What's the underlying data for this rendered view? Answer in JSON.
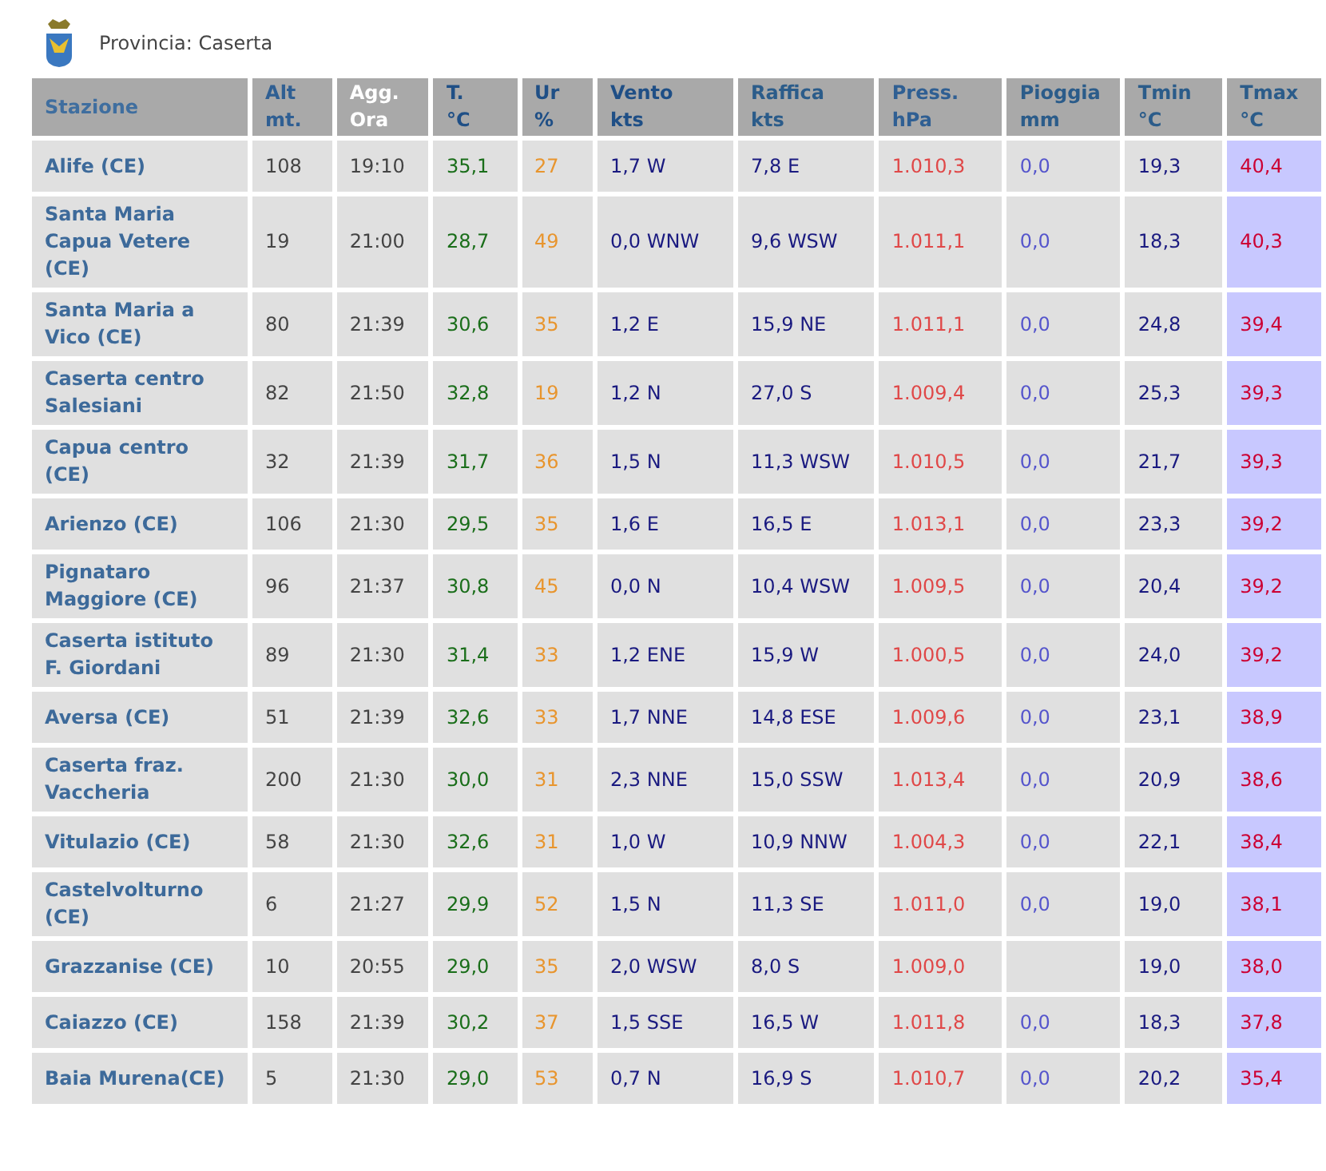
{
  "province": {
    "title": "Provincia: Caserta"
  },
  "table": {
    "columns": [
      {
        "label": "Stazione"
      },
      {
        "label": "Alt\nmt."
      },
      {
        "label": "Agg.\nOra"
      },
      {
        "label": "T.\n°C"
      },
      {
        "label": "Ur\n%"
      },
      {
        "label": "Vento\nkts"
      },
      {
        "label": "Raffica\nkts"
      },
      {
        "label": "Press.\nhPa"
      },
      {
        "label": "Pioggia\nmm"
      },
      {
        "label": "Tmin\n°C"
      },
      {
        "label": "Tmax\n°C"
      }
    ],
    "rows": [
      {
        "station": "Alife (CE)",
        "alt": "108",
        "agg_ora": "19:10",
        "t": "35,1",
        "ur": "27",
        "vento": "1,7 W",
        "raffica": "7,8 E",
        "press": "1.010,3",
        "pioggia": "0,0",
        "tmin": "19,3",
        "tmax": "40,4"
      },
      {
        "station": "Santa Maria Capua Vetere (CE)",
        "alt": "19",
        "agg_ora": "21:00",
        "t": "28,7",
        "ur": "49",
        "vento": "0,0 WNW",
        "raffica": "9,6 WSW",
        "press": "1.011,1",
        "pioggia": "0,0",
        "tmin": "18,3",
        "tmax": "40,3"
      },
      {
        "station": "Santa Maria a Vico (CE)",
        "alt": "80",
        "agg_ora": "21:39",
        "t": "30,6",
        "ur": "35",
        "vento": "1,2 E",
        "raffica": "15,9 NE",
        "press": "1.011,1",
        "pioggia": "0,0",
        "tmin": "24,8",
        "tmax": "39,4"
      },
      {
        "station": "Caserta centro Salesiani",
        "alt": "82",
        "agg_ora": "21:50",
        "t": "32,8",
        "ur": "19",
        "vento": "1,2 N",
        "raffica": "27,0 S",
        "press": "1.009,4",
        "pioggia": "0,0",
        "tmin": "25,3",
        "tmax": "39,3"
      },
      {
        "station": "Capua centro (CE)",
        "alt": "32",
        "agg_ora": "21:39",
        "t": "31,7",
        "ur": "36",
        "vento": "1,5 N",
        "raffica": "11,3 WSW",
        "press": "1.010,5",
        "pioggia": "0,0",
        "tmin": "21,7",
        "tmax": "39,3"
      },
      {
        "station": "Arienzo (CE)",
        "alt": "106",
        "agg_ora": "21:30",
        "t": "29,5",
        "ur": "35",
        "vento": "1,6 E",
        "raffica": "16,5 E",
        "press": "1.013,1",
        "pioggia": "0,0",
        "tmin": "23,3",
        "tmax": "39,2"
      },
      {
        "station": "Pignataro Maggiore (CE)",
        "alt": "96",
        "agg_ora": "21:37",
        "t": "30,8",
        "ur": "45",
        "vento": "0,0 N",
        "raffica": "10,4 WSW",
        "press": "1.009,5",
        "pioggia": "0,0",
        "tmin": "20,4",
        "tmax": "39,2"
      },
      {
        "station": "Caserta istituto F. Giordani",
        "alt": "89",
        "agg_ora": "21:30",
        "t": "31,4",
        "ur": "33",
        "vento": "1,2 ENE",
        "raffica": "15,9 W",
        "press": "1.000,5",
        "pioggia": "0,0",
        "tmin": "24,0",
        "tmax": "39,2"
      },
      {
        "station": "Aversa (CE)",
        "alt": "51",
        "agg_ora": "21:39",
        "t": "32,6",
        "ur": "33",
        "vento": "1,7 NNE",
        "raffica": "14,8 ESE",
        "press": "1.009,6",
        "pioggia": "0,0",
        "tmin": "23,1",
        "tmax": "38,9"
      },
      {
        "station": "Caserta fraz. Vaccheria",
        "alt": "200",
        "agg_ora": "21:30",
        "t": "30,0",
        "ur": "31",
        "vento": "2,3 NNE",
        "raffica": "15,0 SSW",
        "press": "1.013,4",
        "pioggia": "0,0",
        "tmin": "20,9",
        "tmax": "38,6"
      },
      {
        "station": "Vitulazio (CE)",
        "alt": "58",
        "agg_ora": "21:30",
        "t": "32,6",
        "ur": "31",
        "vento": "1,0 W",
        "raffica": "10,9 NNW",
        "press": "1.004,3",
        "pioggia": "0,0",
        "tmin": "22,1",
        "tmax": "38,4"
      },
      {
        "station": "Castelvolturno (CE)",
        "alt": "6",
        "agg_ora": "21:27",
        "t": "29,9",
        "ur": "52",
        "vento": "1,5 N",
        "raffica": "11,3 SE",
        "press": "1.011,0",
        "pioggia": "0,0",
        "tmin": "19,0",
        "tmax": "38,1"
      },
      {
        "station": "Grazzanise (CE)",
        "alt": "10",
        "agg_ora": "20:55",
        "t": "29,0",
        "ur": "35",
        "vento": "2,0 WSW",
        "raffica": "8,0 S",
        "press": "1.009,0",
        "tmin": "19,0",
        "tmax": "38,0"
      },
      {
        "station": "Caiazzo (CE)",
        "alt": "158",
        "agg_ora": "21:39",
        "t": "30,2",
        "ur": "37",
        "vento": "1,5 SSE",
        "raffica": "16,5 W",
        "press": "1.011,8",
        "pioggia": "0,0",
        "tmin": "18,3",
        "tmax": "37,8"
      },
      {
        "station": "Baia Murena(CE)",
        "alt": "5",
        "agg_ora": "21:30",
        "t": "29,0",
        "ur": "53",
        "vento": "0,7 N",
        "raffica": "16,9 S",
        "press": "1.010,7",
        "pioggia": "0,0",
        "tmin": "20,2",
        "tmax": "35,4"
      }
    ]
  }
}
